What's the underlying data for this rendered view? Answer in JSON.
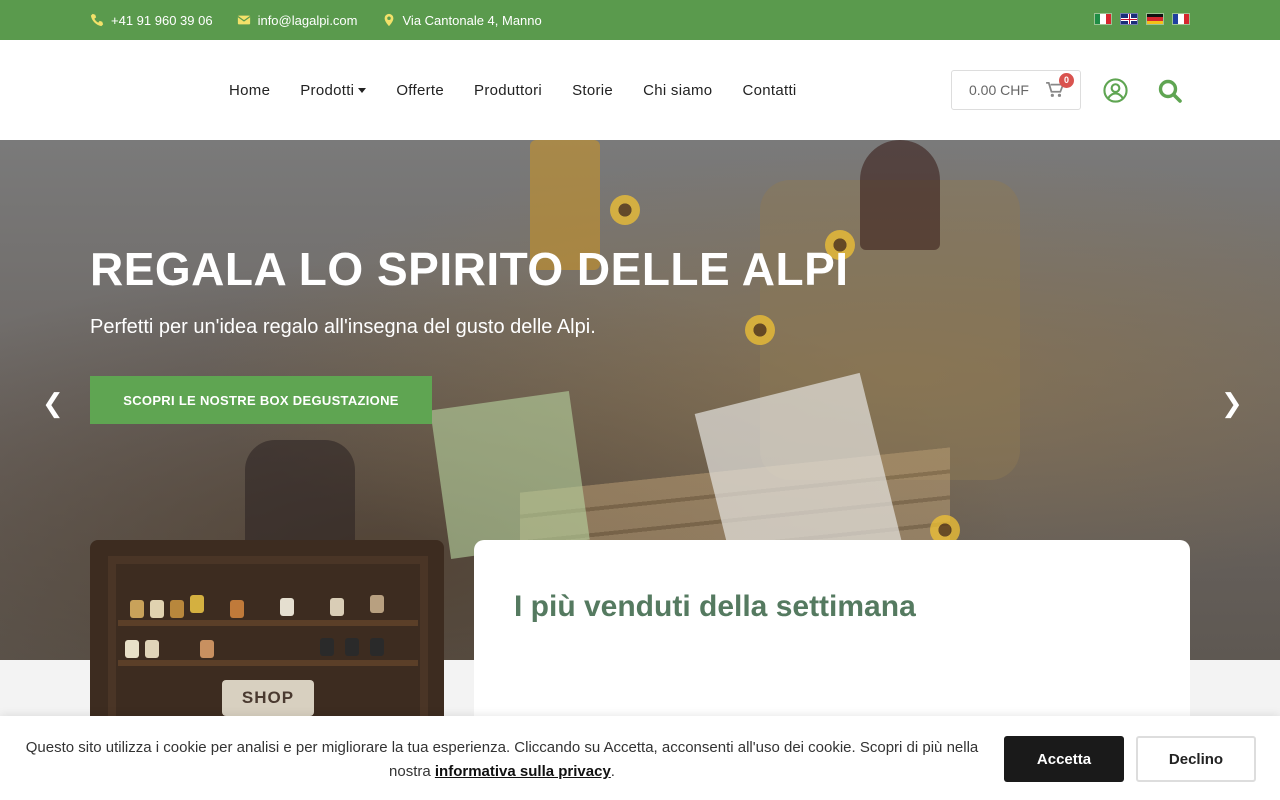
{
  "topbar": {
    "phone": "+41 91 960 39 06",
    "email": "info@lagalpi.com",
    "address": "Via Cantonale 4, Manno",
    "languages": [
      "it-flag-icon",
      "uk-flag-icon",
      "de-flag-icon",
      "fr-flag-icon"
    ],
    "bg_color": "#5a9a4d"
  },
  "nav": {
    "items": [
      "Home",
      "Prodotti",
      "Offerte",
      "Produttori",
      "Storie",
      "Chi siamo",
      "Contatti"
    ]
  },
  "cart": {
    "total": "0.00 CHF",
    "count": "0"
  },
  "hero": {
    "title": "REGALA LO SPIRITO DELLE ALPI",
    "subtitle": "Perfetti per un'idea regalo all'insegna del gusto delle Alpi.",
    "cta": "SCOPRI LE NOSTRE BOX DEGUSTAZIONE",
    "prev": "❮",
    "next": "❯",
    "cta_color": "#5fa552"
  },
  "shop": {
    "sign": "SHOP"
  },
  "bestsellers": {
    "title": "I più venduti della settimana",
    "title_color": "#557a60"
  },
  "cookie": {
    "text": "Questo sito utilizza i cookie per analisi e per migliorare la tua esperienza. Cliccando su Accetta, acconsenti all'uso dei cookie. Scopri di più nella nostra",
    "link": "informativa sulla privacy",
    "end": ".",
    "accept": "Accetta",
    "decline": "Declino"
  }
}
